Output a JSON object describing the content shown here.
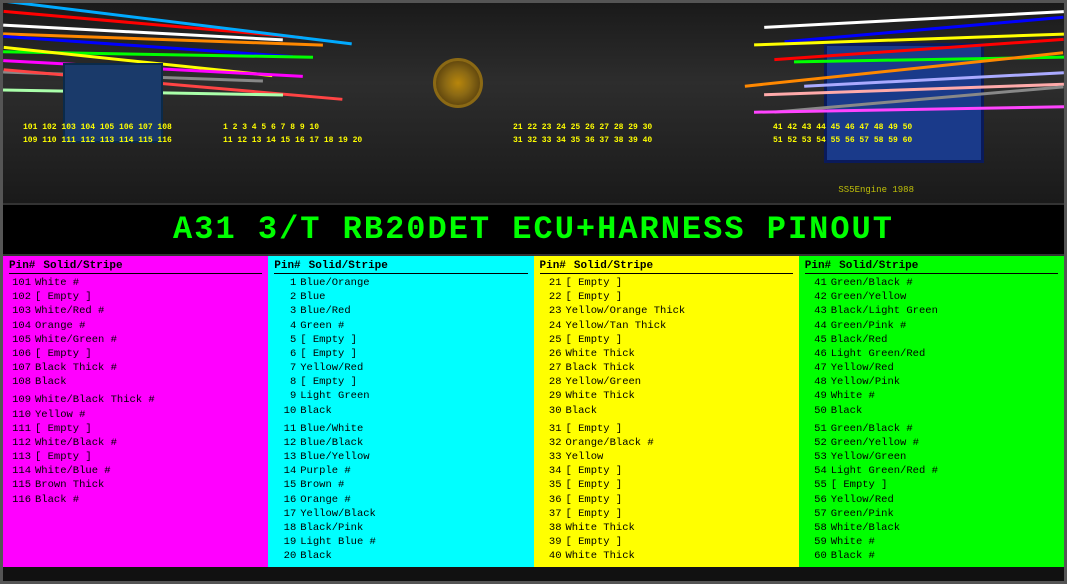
{
  "title": "A31 3/T  RB20DET ECU+HARNESS PINOUT",
  "photo": {
    "pin_labels_top_left": [
      "101 102 103 104 105 106 107 108",
      "109 110 111 112 113 114 115 116"
    ],
    "pin_labels_top_center": [
      "1  2  3  4  5  6  7  8  9 10",
      "11 12 13 14 15 16 17 18 19 20"
    ],
    "pin_labels_top_right1": [
      "21 22 23 24 25 26 27 28 29 30",
      "31 32 33 34 35 36 37 38 39 40"
    ],
    "pin_labels_top_right2": [
      "41 42 43 44 45 46 47 48 49 50",
      "51 52 53 54 55 56 57 58 59 60"
    ]
  },
  "columns": [
    {
      "id": "col1",
      "color_class": "col-magenta",
      "header_pin": "Pin#",
      "header_wire": "Solid/Stripe",
      "rows": [
        {
          "pin": "101",
          "wire": "White #"
        },
        {
          "pin": "102",
          "wire": "[ Empty ]"
        },
        {
          "pin": "103",
          "wire": "White/Red #"
        },
        {
          "pin": "104",
          "wire": "Orange #"
        },
        {
          "pin": "105",
          "wire": "White/Green #"
        },
        {
          "pin": "106",
          "wire": "[ Empty ]"
        },
        {
          "pin": "107",
          "wire": "Black Thick #"
        },
        {
          "pin": "108",
          "wire": "Black"
        },
        {
          "pin": "",
          "wire": ""
        },
        {
          "pin": "109",
          "wire": "White/Black Thick #"
        },
        {
          "pin": "110",
          "wire": "Yellow #"
        },
        {
          "pin": "111",
          "wire": "[ Empty ]"
        },
        {
          "pin": "112",
          "wire": "White/Black #"
        },
        {
          "pin": "113",
          "wire": "[ Empty ]"
        },
        {
          "pin": "114",
          "wire": "White/Blue #"
        },
        {
          "pin": "115",
          "wire": "Brown Thick"
        },
        {
          "pin": "116",
          "wire": "Black #"
        }
      ]
    },
    {
      "id": "col2",
      "color_class": "col-cyan",
      "header_pin": "Pin#",
      "header_wire": "Solid/Stripe",
      "rows": [
        {
          "pin": "1",
          "wire": "Blue/Orange"
        },
        {
          "pin": "2",
          "wire": "Blue"
        },
        {
          "pin": "3",
          "wire": "Blue/Red"
        },
        {
          "pin": "4",
          "wire": "Green #"
        },
        {
          "pin": "5",
          "wire": "[ Empty ]"
        },
        {
          "pin": "6",
          "wire": "[ Empty ]"
        },
        {
          "pin": "7",
          "wire": "Yellow/Red"
        },
        {
          "pin": "8",
          "wire": "[ Empty ]"
        },
        {
          "pin": "9",
          "wire": "Light Green"
        },
        {
          "pin": "10",
          "wire": "Black"
        },
        {
          "pin": "",
          "wire": ""
        },
        {
          "pin": "11",
          "wire": "Blue/White"
        },
        {
          "pin": "12",
          "wire": "Blue/Black"
        },
        {
          "pin": "13",
          "wire": "Blue/Yellow"
        },
        {
          "pin": "14",
          "wire": "Purple #"
        },
        {
          "pin": "15",
          "wire": "Brown #"
        },
        {
          "pin": "16",
          "wire": "Orange #"
        },
        {
          "pin": "17",
          "wire": "Yellow/Black"
        },
        {
          "pin": "18",
          "wire": "Black/Pink"
        },
        {
          "pin": "19",
          "wire": "Light Blue #"
        },
        {
          "pin": "20",
          "wire": "Black"
        }
      ]
    },
    {
      "id": "col3",
      "color_class": "col-yellow",
      "header_pin": "Pin#",
      "header_wire": "Solid/Stripe",
      "rows": [
        {
          "pin": "21",
          "wire": "[ Empty ]"
        },
        {
          "pin": "22",
          "wire": "[ Empty ]"
        },
        {
          "pin": "23",
          "wire": "Yellow/Orange Thick"
        },
        {
          "pin": "24",
          "wire": "Yellow/Tan Thick"
        },
        {
          "pin": "25",
          "wire": "[ Empty ]"
        },
        {
          "pin": "26",
          "wire": "White Thick"
        },
        {
          "pin": "27",
          "wire": "Black Thick"
        },
        {
          "pin": "28",
          "wire": "Yellow/Green"
        },
        {
          "pin": "29",
          "wire": "White Thick"
        },
        {
          "pin": "30",
          "wire": "Black"
        },
        {
          "pin": "",
          "wire": ""
        },
        {
          "pin": "31",
          "wire": "[ Empty ]"
        },
        {
          "pin": "32",
          "wire": "Orange/Black #"
        },
        {
          "pin": "33",
          "wire": "Yellow"
        },
        {
          "pin": "34",
          "wire": "[ Empty ]"
        },
        {
          "pin": "35",
          "wire": "[ Empty ]"
        },
        {
          "pin": "36",
          "wire": "[ Empty ]"
        },
        {
          "pin": "37",
          "wire": "[ Empty ]"
        },
        {
          "pin": "38",
          "wire": "White Thick"
        },
        {
          "pin": "39",
          "wire": "[ Empty ]"
        },
        {
          "pin": "40",
          "wire": "White Thick"
        }
      ]
    },
    {
      "id": "col4",
      "color_class": "col-green",
      "header_pin": "Pin#",
      "header_wire": "Solid/Stripe",
      "rows": [
        {
          "pin": "41",
          "wire": "Green/Black #"
        },
        {
          "pin": "42",
          "wire": "Green/Yellow"
        },
        {
          "pin": "43",
          "wire": "Black/Light Green"
        },
        {
          "pin": "44",
          "wire": "Green/Pink #"
        },
        {
          "pin": "45",
          "wire": "Black/Red"
        },
        {
          "pin": "46",
          "wire": "Light Green/Red"
        },
        {
          "pin": "47",
          "wire": "Yellow/Red"
        },
        {
          "pin": "48",
          "wire": "Yellow/Pink"
        },
        {
          "pin": "49",
          "wire": "White #"
        },
        {
          "pin": "50",
          "wire": "Black"
        },
        {
          "pin": "",
          "wire": ""
        },
        {
          "pin": "51",
          "wire": "Green/Black #"
        },
        {
          "pin": "52",
          "wire": "Green/Yellow #"
        },
        {
          "pin": "53",
          "wire": "Yellow/Green"
        },
        {
          "pin": "54",
          "wire": "Light Green/Red #"
        },
        {
          "pin": "55",
          "wire": "[ Empty ]"
        },
        {
          "pin": "56",
          "wire": "Yellow/Red"
        },
        {
          "pin": "57",
          "wire": "Green/Pink"
        },
        {
          "pin": "58",
          "wire": "White/Black"
        },
        {
          "pin": "59",
          "wire": "White #"
        },
        {
          "pin": "60",
          "wire": "Black #"
        }
      ]
    }
  ]
}
